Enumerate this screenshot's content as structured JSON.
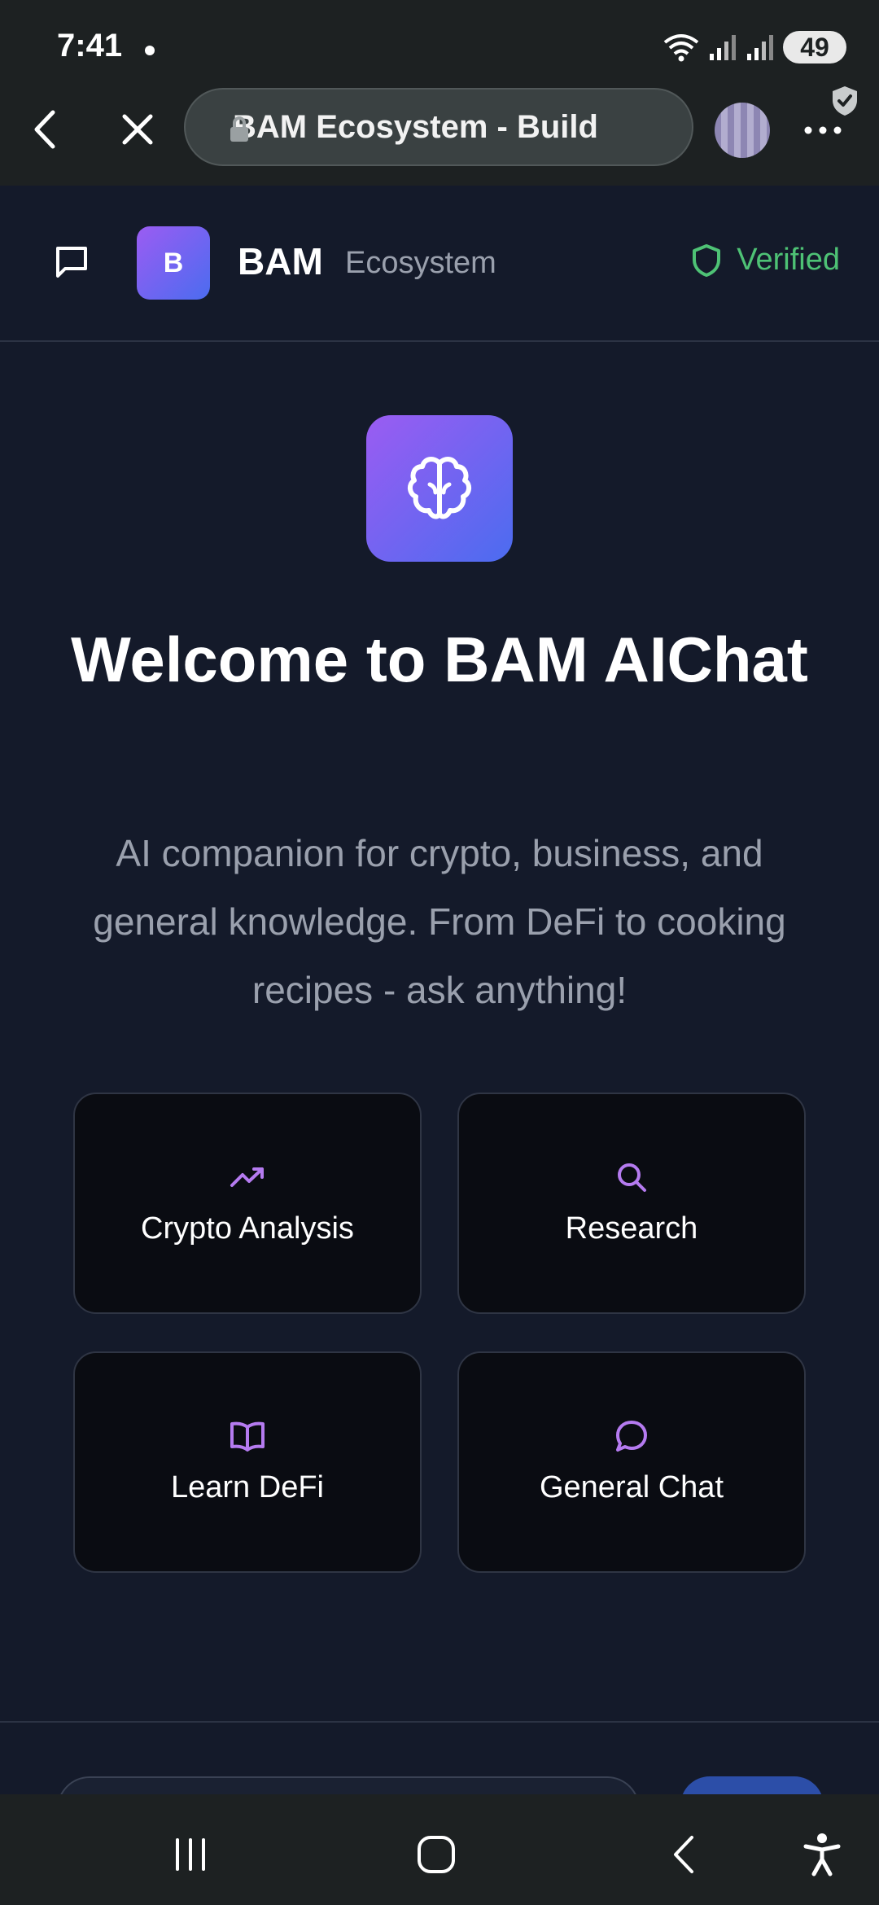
{
  "status_bar": {
    "time": "7:41",
    "battery": "49",
    "icons": [
      "notification-dot",
      "wifi-icon",
      "signal-icon",
      "signal-icon",
      "battery-icon"
    ]
  },
  "browser": {
    "url_title": "BAM Ecosystem - Build",
    "icons": [
      "back-icon",
      "close-icon",
      "lock-icon",
      "avatar",
      "shield-check-icon",
      "more-icon"
    ]
  },
  "header": {
    "logo_letter": "B",
    "brand": "BAM",
    "brand_sub": "Ecosystem",
    "verified_label": "Verified"
  },
  "hero": {
    "title": "Welcome to BAM AIChat",
    "subtitle": "AI companion for crypto, business, and general knowledge. From DeFi to cooking recipes - ask anything!",
    "icon": "brain-icon"
  },
  "cards": [
    {
      "label": "Crypto Analysis",
      "icon": "trending-up-icon"
    },
    {
      "label": "Research",
      "icon": "search-icon"
    },
    {
      "label": "Learn DeFi",
      "icon": "book-icon"
    },
    {
      "label": "General Chat",
      "icon": "message-circle-icon"
    }
  ],
  "colors": {
    "background": "#141a2a",
    "card_background": "#0a0c12",
    "accent_purple": "#9b5cf2",
    "accent_blue": "#4b6cf0",
    "verified_green": "#4ec275",
    "muted_text": "#9aa0ad",
    "icon_purple": "#b57bf0"
  }
}
